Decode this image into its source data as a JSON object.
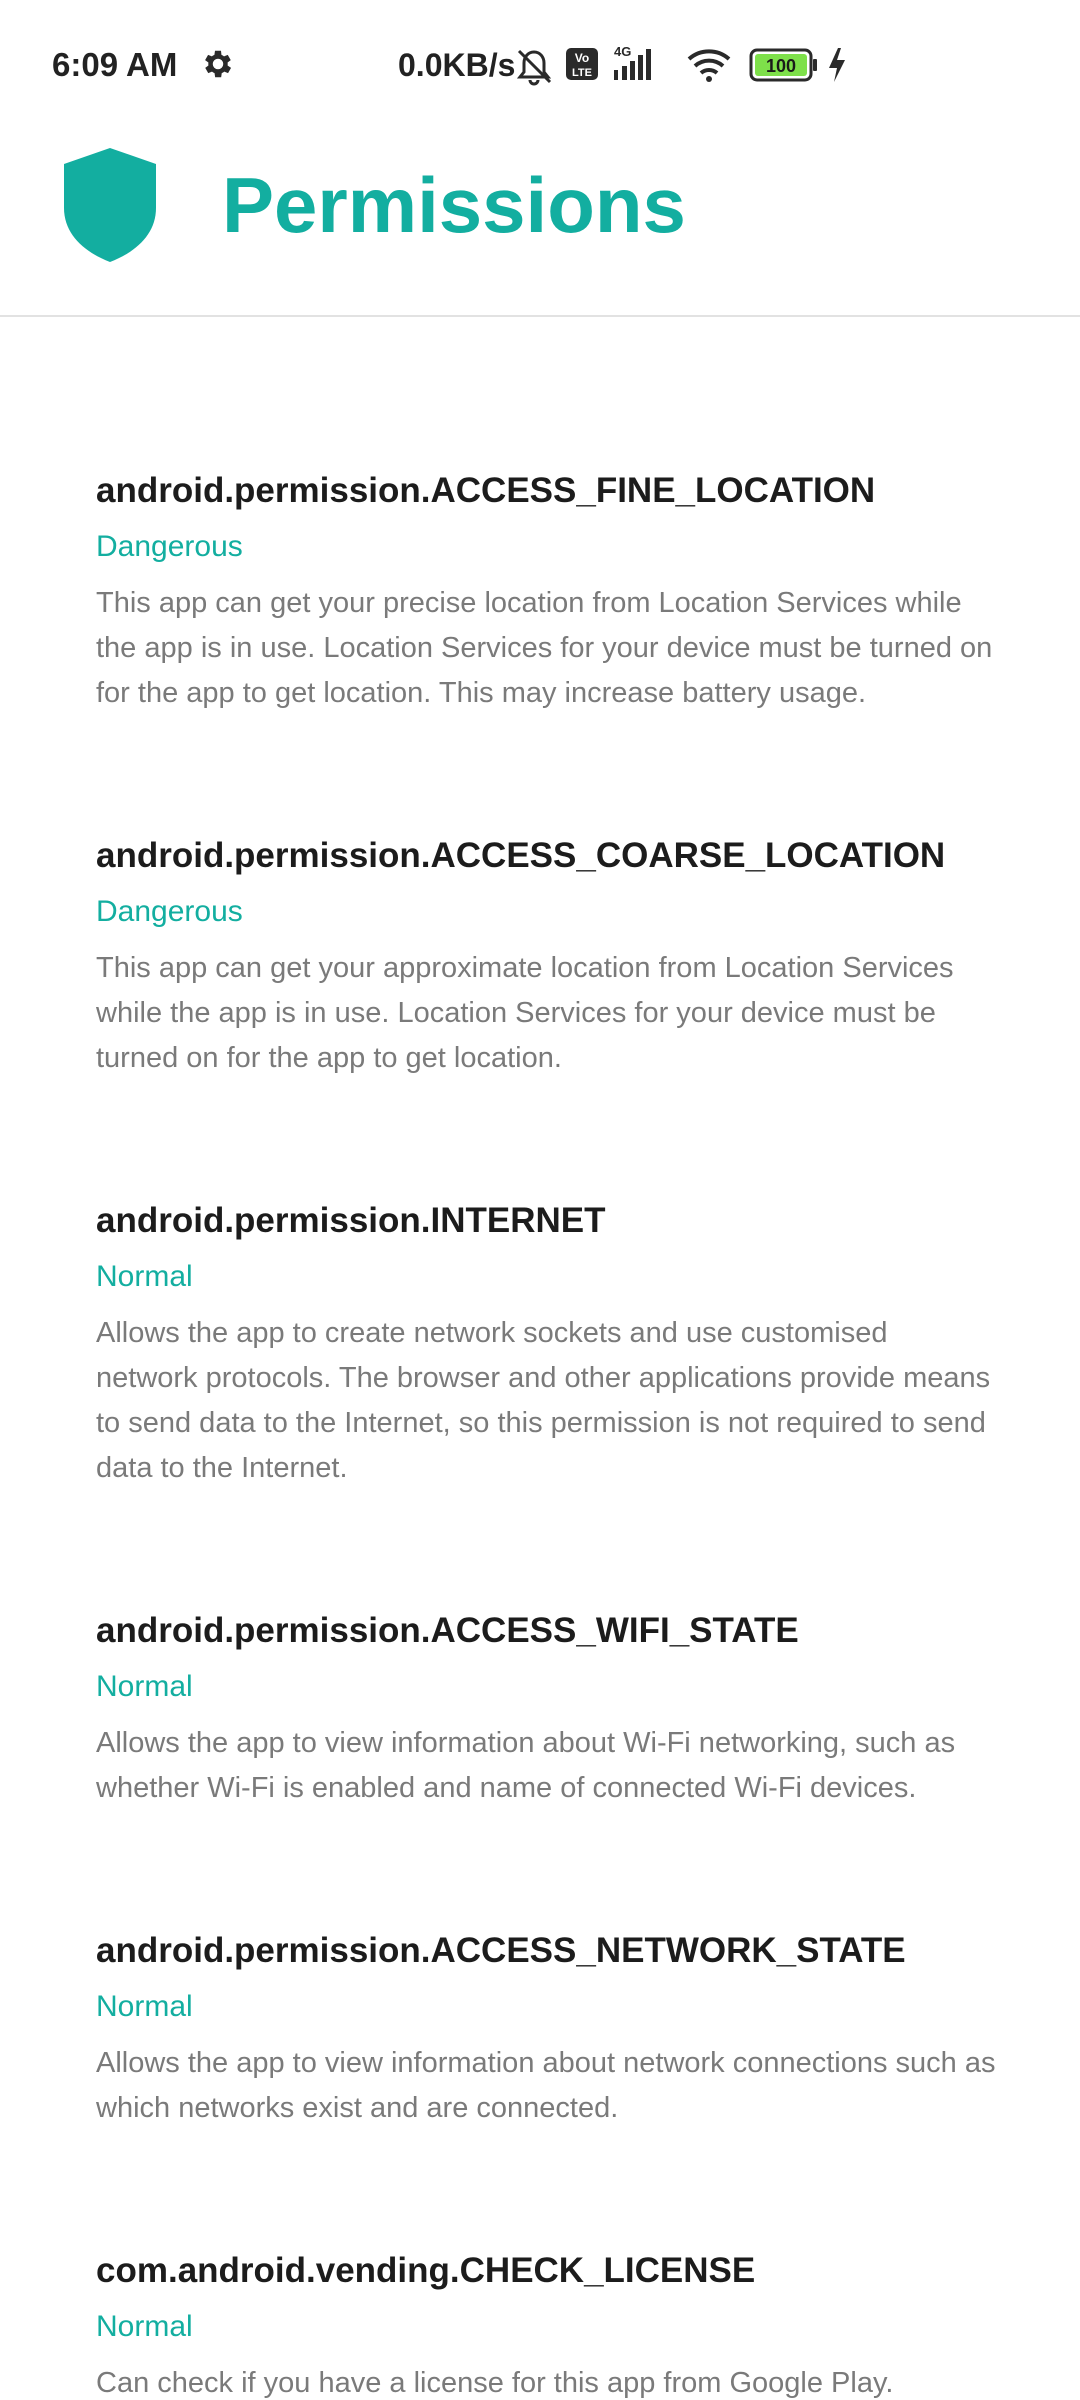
{
  "status_bar": {
    "time": "6:09 AM",
    "network_speed": "0.0KB/s",
    "network_type": "4G",
    "volte_label_top": "Vo",
    "volte_label_bottom": "LTE",
    "battery_level": "100"
  },
  "header": {
    "title": "Permissions",
    "accent_color": "#13aea0"
  },
  "permissions": [
    {
      "name": "android.permission.ACCESS_FINE_LOCATION",
      "level": "Dangerous",
      "description": "This app can get your precise location from Location Services while the app is in use. Location Services for your device must be turned on for the app to get location. This may increase battery usage."
    },
    {
      "name": "android.permission.ACCESS_COARSE_LOCATION",
      "level": "Dangerous",
      "description": "This app can get your approximate location from Location Services while the app is in use. Location Services for your device must be turned on for the app to get location."
    },
    {
      "name": "android.permission.INTERNET",
      "level": "Normal",
      "description": "Allows the app to create network sockets and use customised network protocols. The browser and other applications provide means to send data to the Internet, so this permission is not required to send data to the Internet."
    },
    {
      "name": "android.permission.ACCESS_WIFI_STATE",
      "level": "Normal",
      "description": "Allows the app to view information about Wi-Fi networking, such as whether Wi-Fi is enabled and name of connected Wi-Fi devices."
    },
    {
      "name": "android.permission.ACCESS_NETWORK_STATE",
      "level": "Normal",
      "description": "Allows the app to view information about network connections such as which networks exist and are connected."
    },
    {
      "name": "com.android.vending.CHECK_LICENSE",
      "level": "Normal",
      "description": "Can check if you have a license for this app from Google Play."
    }
  ]
}
